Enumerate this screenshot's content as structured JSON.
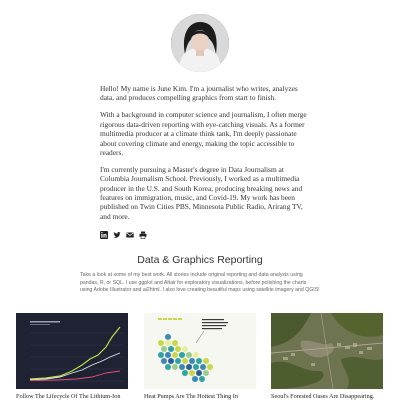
{
  "profile": {
    "avatar_icon": "portrait-photo",
    "bio": [
      "Hello! My name is June Kim. I'm a journalist who writes, analyzes data, and produces compelling graphics from start to finish.",
      "With a background in computer science and journalism, I often merge rigorous data-driven reporting with eye-catching visuals. As a former multimedia producer at a climate think tank, I'm deeply passionate about covering climate and energy, making the topic accessible to readers.",
      "I'm currently pursuing a Master's degree in Data Journalism at Columbia Journalism School. Previously, I worked as a multimedia producer in the U.S. and South Korea, producing breaking news and features on immigration, music, and Covid-19. My work has been published on Twin Cities PBS, Minnesota Public Radio, Arirang TV, and more."
    ],
    "social_icons": [
      "linkedin-icon",
      "twitter-icon",
      "email-icon",
      "print-icon"
    ]
  },
  "reporting": {
    "title": "Data & Graphics Reporting",
    "description": "Take a look at some of my best work. All stories include original reporting and data analysis using pandas, R, or SQL. I use ggplot and Altair for exploratory visualizations, before polishing the charts using Adobe Illustrator and ai2html. I also love creating beautiful maps using satellite imagery and QGIS!"
  },
  "cards": [
    {
      "caption": "Follow The Lifecycle Of The Lithium-Ion"
    },
    {
      "caption": "Heat Pumps Are The Hottest Thing In"
    },
    {
      "caption": "Seoul's Forested Oases Are Disappearing."
    }
  ],
  "colors": {
    "dark_thumb": "#1e2233",
    "hex_teal": "#2fa3a0",
    "forest": "#5a6b3a"
  }
}
